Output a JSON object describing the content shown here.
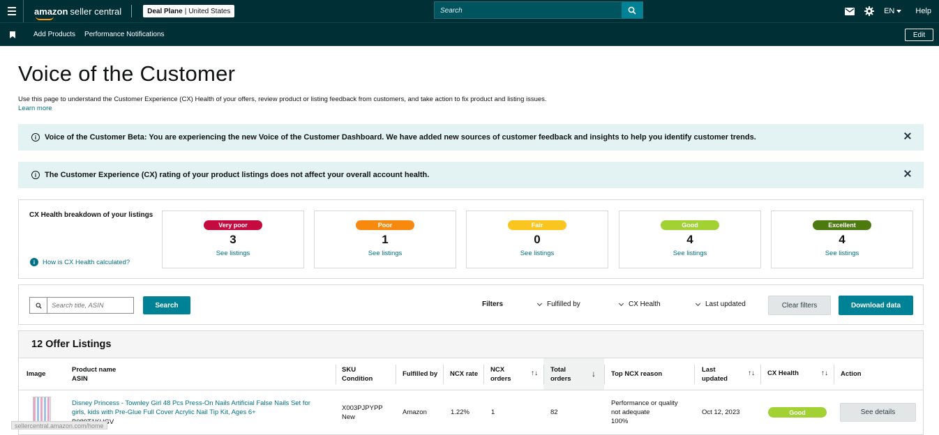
{
  "topbar": {
    "logo_bold": "amazon",
    "logo_light": "seller central",
    "store_name": "Deal Plane",
    "store_region": "United States",
    "search_placeholder": "Search",
    "language": "EN",
    "help": "Help"
  },
  "navbar": {
    "links": [
      "Add Products",
      "Performance Notifications"
    ],
    "edit": "Edit"
  },
  "page": {
    "title": "Voice of the Customer",
    "description": "Use this page to understand the Customer Experience (CX) Health of your offers, review product or listing feedback from customers, and take action to fix product and listing issues.",
    "learn_more": "Learn more"
  },
  "alerts": [
    "Voice of the Customer Beta: You are experiencing the new Voice of the Customer Dashboard. We have added new sources of customer feedback and insights to help you identify customer trends.",
    "The Customer Experience (CX) rating of your product listings does not affect your overall account health."
  ],
  "cx_breakdown": {
    "label": "CX Health breakdown of your listings",
    "how_link": "How is CX Health calculated?",
    "cards": [
      {
        "rating": "Very poor",
        "count": "3",
        "link": "See listings",
        "color": "#c40a3e"
      },
      {
        "rating": "Poor",
        "count": "1",
        "link": "See listings",
        "color": "#f7890f"
      },
      {
        "rating": "Fair",
        "count": "0",
        "link": "See listings",
        "color": "#fbc520"
      },
      {
        "rating": "Good",
        "count": "4",
        "link": "See listings",
        "color": "#a1d133"
      },
      {
        "rating": "Excellent",
        "count": "4",
        "link": "See listings",
        "color": "#4c7a0f"
      }
    ]
  },
  "filters": {
    "search_placeholder": "Search title, ASIN",
    "search_button": "Search",
    "label": "Filters",
    "dropdowns": [
      "Fulfilled by",
      "CX Health",
      "Last updated"
    ],
    "clear": "Clear filters",
    "download": "Download data"
  },
  "table": {
    "title": "12 Offer Listings",
    "headers": {
      "image": "Image",
      "product_name": "Product name",
      "asin": "ASIN",
      "sku": "SKU",
      "condition": "Condition",
      "fulfilled_by": "Fulfilled by",
      "ncx_rate": "NCX rate",
      "ncx_orders_1": "NCX",
      "ncx_orders_2": "orders",
      "total_orders_1": "Total",
      "total_orders_2": "orders",
      "top_reason": "Top NCX reason",
      "last_updated_1": "Last",
      "last_updated_2": "updated",
      "cx_health": "CX Health",
      "action": "Action"
    },
    "rows": [
      {
        "product_line1": "Disney Princess - Townley Girl 48 Pcs Press-On Nails Artificial False Nails Set for",
        "product_line2": "girls, kids with Pre-Glue Full Cover Acrylic Nail Tip Kit, Ages 6+",
        "asin": "B089T1KHGV",
        "sku": "X003PJPYPP",
        "condition": "New",
        "fulfilled_by": "Amazon",
        "ncx_rate": "1.22%",
        "ncx_orders": "1",
        "total_orders": "82",
        "reason_line1": "Performance or quality",
        "reason_line2": "not adequate",
        "reason_pct": "100%",
        "last_updated": "Oct 12, 2023",
        "cx_health": "Good",
        "action": "See details"
      }
    ]
  },
  "status_url": "sellercentral.amazon.com/home"
}
